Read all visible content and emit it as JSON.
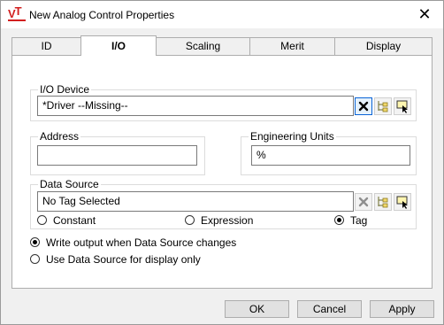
{
  "window": {
    "title": "New Analog Control Properties",
    "app_icon": "vt-logo",
    "close_glyph": "✕"
  },
  "tabs": [
    {
      "label": "ID",
      "active": false
    },
    {
      "label": "I/O",
      "active": true
    },
    {
      "label": "Scaling",
      "active": false
    },
    {
      "label": "Merit",
      "active": false
    },
    {
      "label": "Display",
      "active": false
    }
  ],
  "io_device": {
    "label": "I/O Device",
    "value": "*Driver    --Missing--"
  },
  "address": {
    "label": "Address",
    "value": ""
  },
  "engineering_units": {
    "label": "Engineering Units",
    "value": "%"
  },
  "data_source": {
    "label": "Data Source",
    "value": "No Tag Selected",
    "options": [
      {
        "label": "Constant",
        "selected": false
      },
      {
        "label": "Expression",
        "selected": false
      },
      {
        "label": "Tag",
        "selected": true
      }
    ]
  },
  "output_mode": {
    "options": [
      {
        "label": "Write output when Data Source changes",
        "selected": true
      },
      {
        "label": "Use Data Source for display only",
        "selected": false
      }
    ]
  },
  "buttons": {
    "ok": "OK",
    "cancel": "Cancel",
    "apply": "Apply"
  },
  "colors": {
    "accent": "#0a64d6",
    "brand": "#d21f1f"
  }
}
